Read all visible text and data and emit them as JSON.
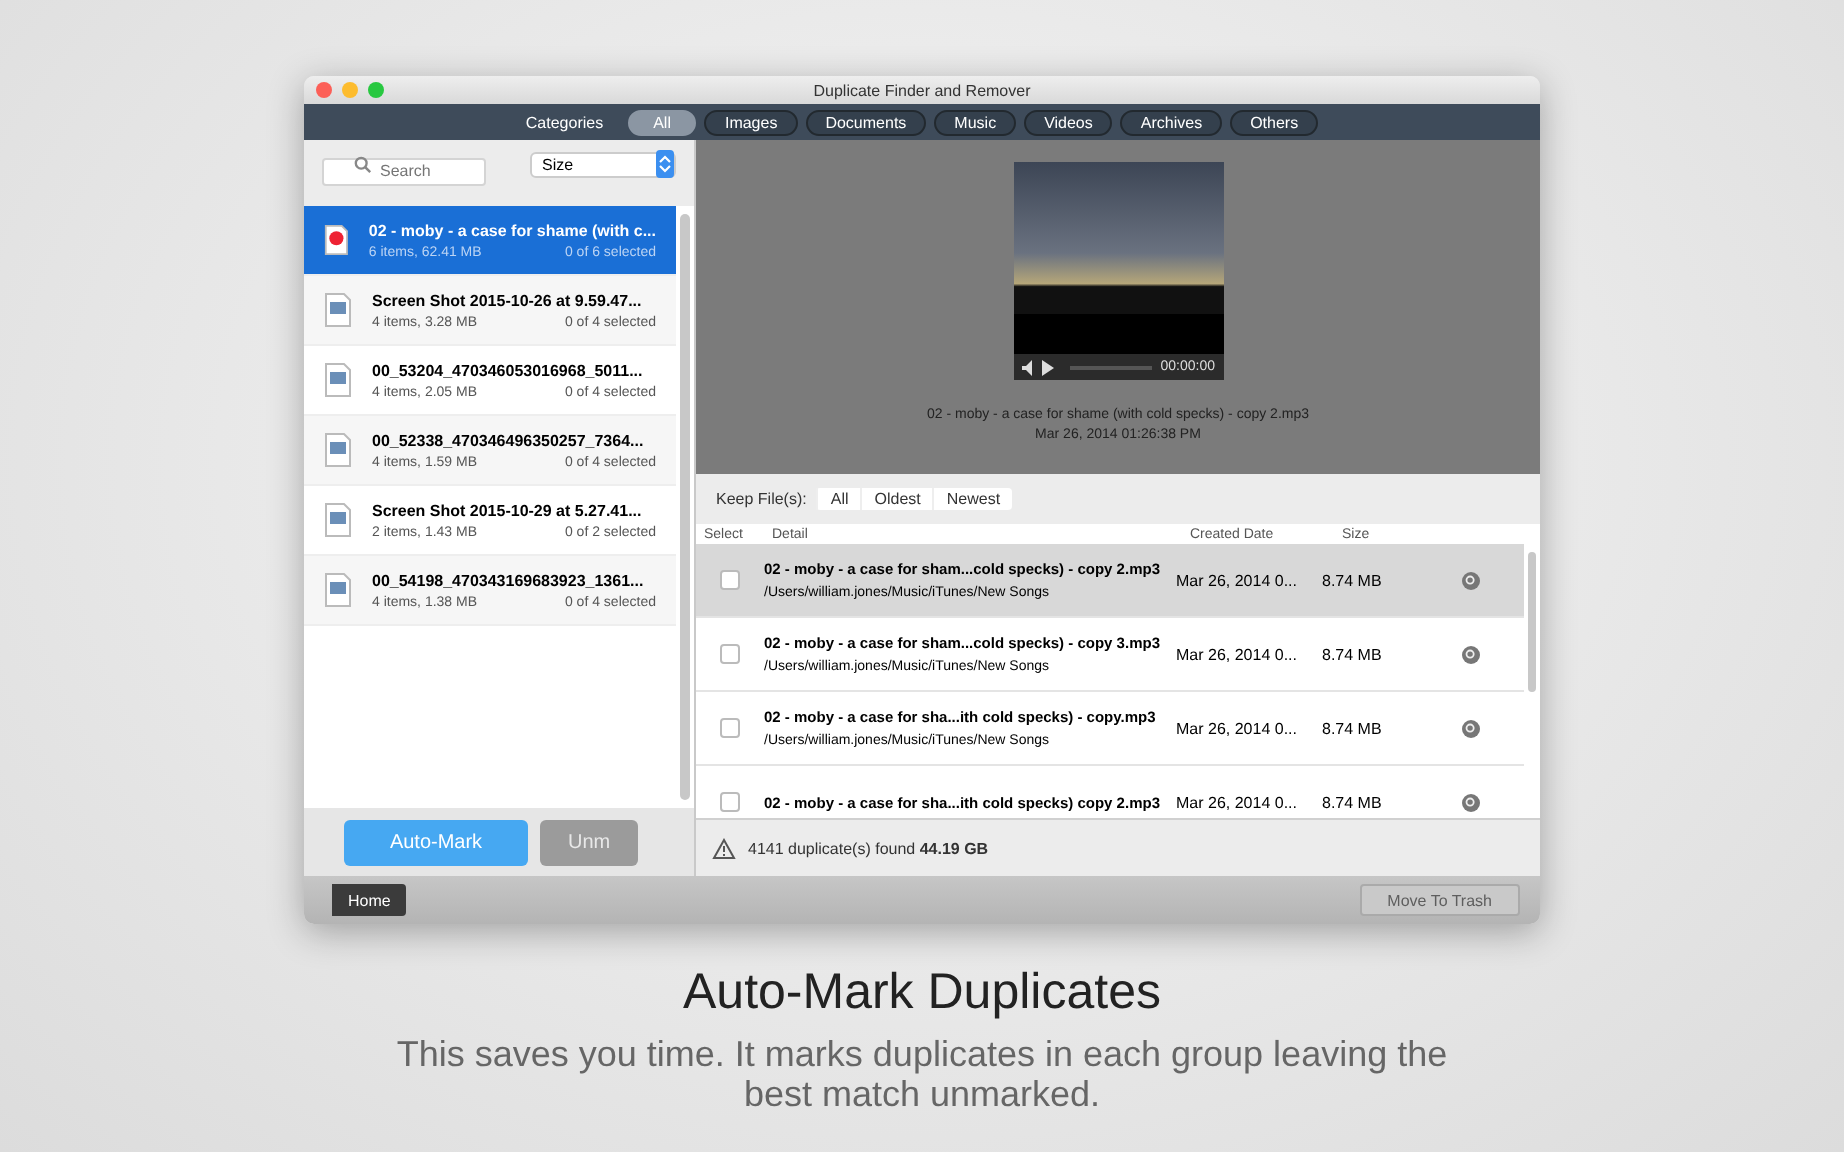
{
  "window": {
    "title": "Duplicate Finder and Remover"
  },
  "categories": {
    "label": "Categories",
    "tabs": [
      {
        "label": "All",
        "selected": true
      },
      {
        "label": "Images",
        "selected": false
      },
      {
        "label": "Documents",
        "selected": false
      },
      {
        "label": "Music",
        "selected": false
      },
      {
        "label": "Videos",
        "selected": false
      },
      {
        "label": "Archives",
        "selected": false
      },
      {
        "label": "Others",
        "selected": false
      }
    ]
  },
  "sidebar": {
    "search": {
      "placeholder": "Search"
    },
    "sort": "Size",
    "groups": [
      {
        "kind": "music",
        "name": "02 - moby - a case for shame (with c...",
        "info": "6 items, 62.41 MB",
        "selection": "0 of 6 selected",
        "selected": true
      },
      {
        "kind": "image",
        "name": "Screen Shot 2015-10-26 at 9.59.47...",
        "info": "4 items, 3.28 MB",
        "selection": "0 of 4 selected",
        "selected": false
      },
      {
        "kind": "image",
        "name": "00_53204_470346053016968_5011...",
        "info": "4 items, 2.05 MB",
        "selection": "0 of 4 selected",
        "selected": false
      },
      {
        "kind": "image",
        "name": "00_52338_470346496350257_7364...",
        "info": "4 items, 1.59 MB",
        "selection": "0 of 4 selected",
        "selected": false
      },
      {
        "kind": "image",
        "name": "Screen Shot 2015-10-29 at 5.27.41...",
        "info": "2 items, 1.43 MB",
        "selection": "0 of 2 selected",
        "selected": false
      },
      {
        "kind": "image",
        "name": "00_54198_470343169683923_1361...",
        "info": "4 items, 1.38 MB",
        "selection": "0 of 4 selected",
        "selected": false
      }
    ],
    "buttons": [
      {
        "label": "Auto-Mark",
        "kind": "primary"
      },
      {
        "label": "Unm",
        "kind": "secondary"
      }
    ]
  },
  "preview": {
    "time": "00:00:00",
    "title": "02 - moby - a case for shame (with cold specks) - copy 2.mp3",
    "date": "Mar 26, 2014 01:26:38 PM"
  },
  "keep_files": {
    "label": "Keep File(s):",
    "options": [
      "All",
      "Oldest",
      "Newest"
    ]
  },
  "table": {
    "columns": [
      "Select",
      "Detail",
      "Created Date",
      "Size"
    ],
    "rows": [
      {
        "name": "02 - moby - a case for sham...cold specks) - copy 2.mp3",
        "path": "/Users/william.jones/Music/iTunes/New Songs",
        "date": "Mar 26, 2014 0...",
        "size": "8.74 MB",
        "checked": false,
        "selected": true
      },
      {
        "name": "02 - moby - a case for sham...cold specks) - copy 3.mp3",
        "path": "/Users/william.jones/Music/iTunes/New Songs",
        "date": "Mar 26, 2014 0...",
        "size": "8.74 MB",
        "checked": false,
        "selected": false
      },
      {
        "name": "02 - moby - a case for sha...ith cold specks) - copy.mp3",
        "path": "/Users/william.jones/Music/iTunes/New Songs",
        "date": "Mar 26, 2014 0...",
        "size": "8.74 MB",
        "checked": false,
        "selected": false
      },
      {
        "name": "02 - moby - a case for sha...ith cold specks) copy 2.mp3",
        "path": "",
        "date": "Mar 26, 2014 0...",
        "size": "8.74 MB",
        "checked": false,
        "selected": false
      }
    ]
  },
  "status_bar": {
    "count": "4141",
    "text": "duplicate(s) found",
    "total": "44.19 GB"
  },
  "bottom_bar": {
    "home": "Home",
    "trash": {
      "label": "Move To Trash",
      "disabled": true
    }
  },
  "headline": "Auto-Mark Duplicates",
  "description": "This saves you time. It marks duplicates in each group leaving the best match unmarked."
}
